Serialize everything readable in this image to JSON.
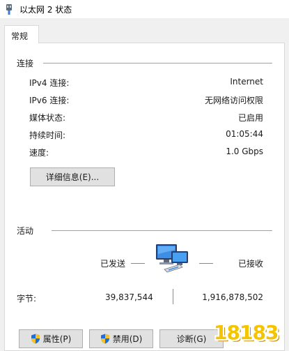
{
  "window": {
    "title": "以太网 2 状态"
  },
  "tabs": [
    {
      "label": "常规"
    }
  ],
  "connection": {
    "title": "连接",
    "rows": [
      {
        "label": "IPv4 连接:",
        "value": "Internet"
      },
      {
        "label": "IPv6 连接:",
        "value": "无网络访问权限"
      },
      {
        "label": "媒体状态:",
        "value": "已启用"
      },
      {
        "label": "持续时间:",
        "value": "01:05:44"
      },
      {
        "label": "速度:",
        "value": "1.0 Gbps"
      }
    ],
    "details_button": "详细信息(E)..."
  },
  "activity": {
    "title": "活动",
    "sent_label": "已发送",
    "received_label": "已接收",
    "bytes_label": "字节:",
    "bytes_sent": "39,837,544",
    "bytes_received": "1,916,878,502"
  },
  "buttons": {
    "properties": "属性(P)",
    "disable": "禁用(D)",
    "diagnose": "诊断(G)"
  },
  "watermark": {
    "text": "18183"
  },
  "icons": {
    "title": "ethernet-plug-icon",
    "network": "network-computers-icon",
    "shield": "uac-shield-icon"
  },
  "colors": {
    "accent": "#1e6fd9",
    "watermark": "#f4c400"
  }
}
